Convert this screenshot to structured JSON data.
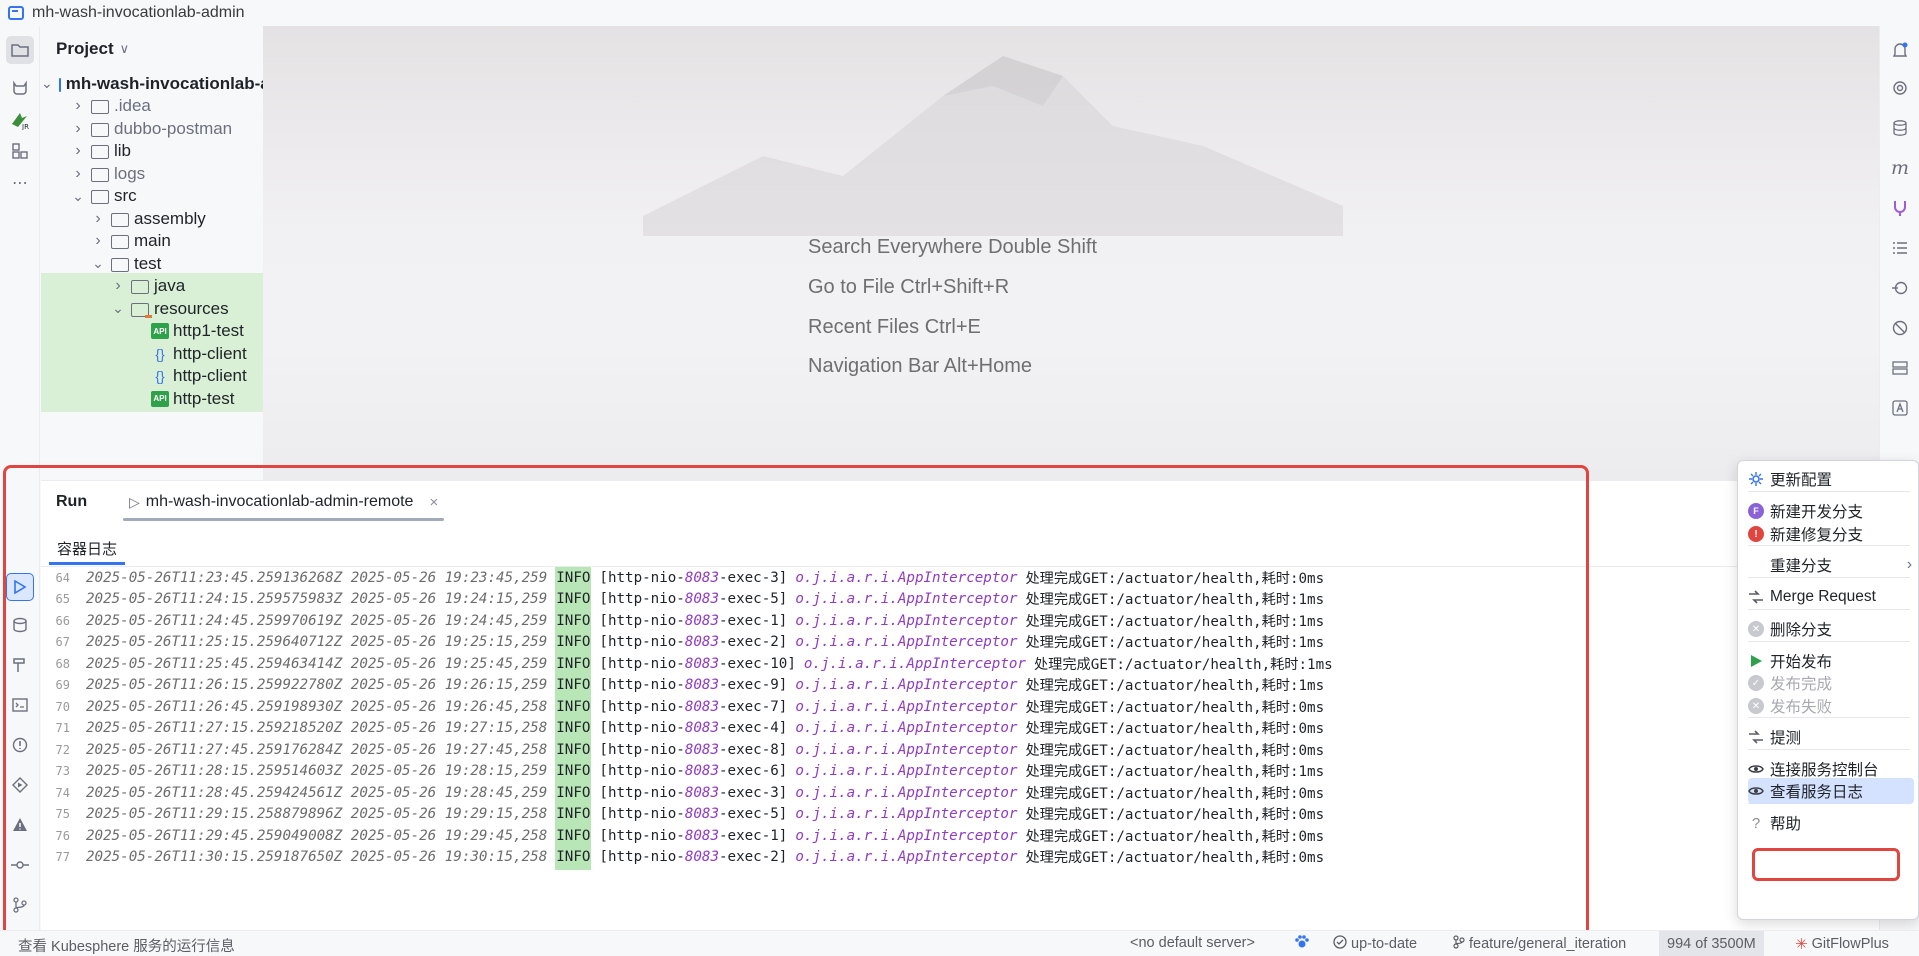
{
  "window": {
    "title": "mh-wash-invocationlab-admin"
  },
  "project_panel": {
    "title": "Project",
    "tree": [
      {
        "label": "mh-wash-invocationlab-admin",
        "level": 0,
        "expanded": true,
        "kind": "module"
      },
      {
        "label": ".idea",
        "level": 1,
        "expanded": false,
        "kind": "folder"
      },
      {
        "label": "dubbo-postman",
        "level": 1,
        "expanded": false,
        "kind": "folder"
      },
      {
        "label": "lib",
        "level": 1,
        "expanded": false,
        "kind": "folder"
      },
      {
        "label": "logs",
        "level": 1,
        "expanded": false,
        "kind": "folder"
      },
      {
        "label": "src",
        "level": 1,
        "expanded": true,
        "kind": "folder"
      },
      {
        "label": "assembly",
        "level": 2,
        "expanded": false,
        "kind": "folder"
      },
      {
        "label": "main",
        "level": 2,
        "expanded": false,
        "kind": "folder"
      },
      {
        "label": "test",
        "level": 2,
        "expanded": true,
        "kind": "folder"
      },
      {
        "label": "java",
        "level": 3,
        "expanded": false,
        "kind": "folder"
      },
      {
        "label": "resources",
        "level": 3,
        "expanded": true,
        "kind": "resources"
      },
      {
        "label": "http1-test",
        "level": 4,
        "kind": "api"
      },
      {
        "label": "http-client",
        "level": 4,
        "kind": "json"
      },
      {
        "label": "http-client",
        "level": 4,
        "kind": "json"
      },
      {
        "label": "http-test",
        "level": 4,
        "kind": "api"
      }
    ]
  },
  "editor": {
    "hints": [
      "Search Everywhere Double Shift",
      "Go to File Ctrl+Shift+R",
      "Recent Files Ctrl+E",
      "Navigation Bar Alt+Home"
    ]
  },
  "run_panel": {
    "label": "Run",
    "tab": "mh-wash-invocationlab-admin-remote",
    "close": "×",
    "sub_tab": "容器日志",
    "log_lines": [
      {
        "n": "64",
        "ts": "2025-05-26T11:23:45.259136268Z 2025-05-26 19:23:45,259",
        "level": "INFO",
        "pre": "[http-nio-",
        "port": "8083",
        "post": "-exec-3]",
        "cls": "o.j.i.a.r.i.AppInterceptor",
        "msg": "处理完成GET:/actuator/health,耗时:0ms"
      },
      {
        "n": "65",
        "ts": "2025-05-26T11:24:15.259575983Z 2025-05-26 19:24:15,259",
        "level": "INFO",
        "pre": "[http-nio-",
        "port": "8083",
        "post": "-exec-5]",
        "cls": "o.j.i.a.r.i.AppInterceptor",
        "msg": "处理完成GET:/actuator/health,耗时:1ms"
      },
      {
        "n": "66",
        "ts": "2025-05-26T11:24:45.259970619Z 2025-05-26 19:24:45,259",
        "level": "INFO",
        "pre": "[http-nio-",
        "port": "8083",
        "post": "-exec-1]",
        "cls": "o.j.i.a.r.i.AppInterceptor",
        "msg": "处理完成GET:/actuator/health,耗时:1ms"
      },
      {
        "n": "67",
        "ts": "2025-05-26T11:25:15.259640712Z 2025-05-26 19:25:15,259",
        "level": "INFO",
        "pre": "[http-nio-",
        "port": "8083",
        "post": "-exec-2]",
        "cls": "o.j.i.a.r.i.AppInterceptor",
        "msg": "处理完成GET:/actuator/health,耗时:1ms"
      },
      {
        "n": "68",
        "ts": "2025-05-26T11:25:45.259463414Z 2025-05-26 19:25:45,259",
        "level": "INFO",
        "pre": "[http-nio-",
        "port": "8083",
        "post": "-exec-10]",
        "cls": "o.j.i.a.r.i.AppInterceptor",
        "msg": "处理完成GET:/actuator/health,耗时:1ms"
      },
      {
        "n": "69",
        "ts": "2025-05-26T11:26:15.259922780Z 2025-05-26 19:26:15,259",
        "level": "INFO",
        "pre": "[http-nio-",
        "port": "8083",
        "post": "-exec-9]",
        "cls": "o.j.i.a.r.i.AppInterceptor",
        "msg": "处理完成GET:/actuator/health,耗时:1ms"
      },
      {
        "n": "70",
        "ts": "2025-05-26T11:26:45.259198930Z 2025-05-26 19:26:45,258",
        "level": "INFO",
        "pre": "[http-nio-",
        "port": "8083",
        "post": "-exec-7]",
        "cls": "o.j.i.a.r.i.AppInterceptor",
        "msg": "处理完成GET:/actuator/health,耗时:0ms"
      },
      {
        "n": "71",
        "ts": "2025-05-26T11:27:15.259218520Z 2025-05-26 19:27:15,258",
        "level": "INFO",
        "pre": "[http-nio-",
        "port": "8083",
        "post": "-exec-4]",
        "cls": "o.j.i.a.r.i.AppInterceptor",
        "msg": "处理完成GET:/actuator/health,耗时:0ms"
      },
      {
        "n": "72",
        "ts": "2025-05-26T11:27:45.259176284Z 2025-05-26 19:27:45,258",
        "level": "INFO",
        "pre": "[http-nio-",
        "port": "8083",
        "post": "-exec-8]",
        "cls": "o.j.i.a.r.i.AppInterceptor",
        "msg": "处理完成GET:/actuator/health,耗时:0ms"
      },
      {
        "n": "73",
        "ts": "2025-05-26T11:28:15.259514603Z 2025-05-26 19:28:15,259",
        "level": "INFO",
        "pre": "[http-nio-",
        "port": "8083",
        "post": "-exec-6]",
        "cls": "o.j.i.a.r.i.AppInterceptor",
        "msg": "处理完成GET:/actuator/health,耗时:1ms"
      },
      {
        "n": "74",
        "ts": "2025-05-26T11:28:45.259424561Z 2025-05-26 19:28:45,259",
        "level": "INFO",
        "pre": "[http-nio-",
        "port": "8083",
        "post": "-exec-3]",
        "cls": "o.j.i.a.r.i.AppInterceptor",
        "msg": "处理完成GET:/actuator/health,耗时:0ms"
      },
      {
        "n": "75",
        "ts": "2025-05-26T11:29:15.258879896Z 2025-05-26 19:29:15,258",
        "level": "INFO",
        "pre": "[http-nio-",
        "port": "8083",
        "post": "-exec-5]",
        "cls": "o.j.i.a.r.i.AppInterceptor",
        "msg": "处理完成GET:/actuator/health,耗时:0ms"
      },
      {
        "n": "76",
        "ts": "2025-05-26T11:29:45.259049008Z 2025-05-26 19:29:45,258",
        "level": "INFO",
        "pre": "[http-nio-",
        "port": "8083",
        "post": "-exec-1]",
        "cls": "o.j.i.a.r.i.AppInterceptor",
        "msg": "处理完成GET:/actuator/health,耗时:0ms"
      },
      {
        "n": "77",
        "ts": "2025-05-26T11:30:15.259187650Z 2025-05-26 19:30:15,258",
        "level": "INFO",
        "pre": "[http-nio-",
        "port": "8083",
        "post": "-exec-2]",
        "cls": "o.j.i.a.r.i.AppInterceptor",
        "msg": "处理完成GET:/actuator/health,耗时:0ms"
      }
    ]
  },
  "context_menu": {
    "items": [
      {
        "label": "更新配置",
        "icon": "gear-icon",
        "state": "normal"
      },
      {
        "label": "新建开发分支",
        "icon": "f-badge-icon",
        "state": "normal"
      },
      {
        "label": "新建修复分支",
        "icon": "alert-icon",
        "state": "normal"
      },
      {
        "label": "重建分支",
        "icon": "",
        "state": "submenu"
      },
      {
        "label": "Merge Request",
        "icon": "merge-icon",
        "state": "normal"
      },
      {
        "label": "删除分支",
        "icon": "delete-icon",
        "state": "normal"
      },
      {
        "label": "开始发布",
        "icon": "play-icon",
        "state": "normal"
      },
      {
        "label": "发布完成",
        "icon": "check-circle-icon",
        "state": "disabled"
      },
      {
        "label": "发布失败",
        "icon": "x-circle-icon",
        "state": "disabled"
      },
      {
        "label": "提测",
        "icon": "merge-icon",
        "state": "normal"
      },
      {
        "label": "连接服务控制台",
        "icon": "eye-icon",
        "state": "normal"
      },
      {
        "label": "查看服务日志",
        "icon": "eye-icon",
        "state": "selected"
      },
      {
        "label": "帮助",
        "icon": "question-icon",
        "state": "normal"
      }
    ]
  },
  "status_bar": {
    "message": "查看 Kubesphere 服务的运行信息",
    "server": "<no default server>",
    "update": "up-to-date",
    "branch": "feature/general_iteration",
    "memory": "994 of 3500M",
    "plugin": "GitFlowPlus"
  },
  "colors": {
    "accent": "#3574f0",
    "highlight_red": "#e0453f",
    "info_level_bg": "#b9e6b6",
    "tree_highlight": "#d9f0d6"
  }
}
